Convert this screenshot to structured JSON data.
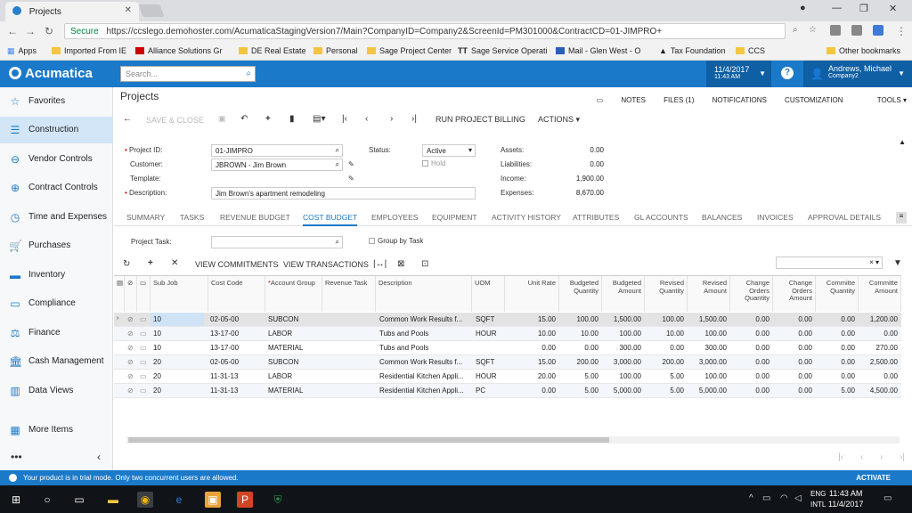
{
  "browser": {
    "tab_title": "Projects",
    "secure_label": "Secure",
    "url": "https://ccslego.demohoster.com/AcumaticaStagingVersion7/Main?CompanyID=Company2&ScreenId=PM301000&ContractCD=01-JIMPRO+",
    "bookmarks": [
      "Apps",
      "Imported From IE",
      "Alliance Solutions Gr",
      "DE Real Estate",
      "Personal",
      "Sage Project Center",
      "Sage Service Operati",
      "Mail - Glen West - O",
      "Tax Foundation",
      "CCS",
      "Other bookmarks"
    ]
  },
  "app": {
    "brand": "Acumatica",
    "search_placeholder": "Search...",
    "date": "11/4/2017",
    "time": "11:43 AM",
    "user_name": "Andrews, Michael",
    "company": "Company2"
  },
  "sidebar": {
    "items": [
      "Favorites",
      "Construction",
      "Vendor Controls",
      "Contract Controls",
      "Time and Expenses",
      "Purchases",
      "Inventory",
      "Compliance",
      "Finance",
      "Cash Management",
      "Data Views",
      "More Items"
    ],
    "active": "Construction"
  },
  "page": {
    "title": "Projects",
    "top_links": [
      "NOTES",
      "FILES (1)",
      "NOTIFICATIONS",
      "CUSTOMIZATION",
      "TOOLS"
    ],
    "toolbar": {
      "save_close": "SAVE & CLOSE",
      "run_billing": "RUN PROJECT BILLING",
      "actions": "ACTIONS"
    }
  },
  "form": {
    "project_id_label": "Project ID:",
    "project_id": "01-JIMPRO",
    "customer_label": "Customer:",
    "customer": "JBROWN - Jim Brown",
    "template_label": "Template:",
    "template": "",
    "description_label": "Description:",
    "description": "Jim Brown's apartment remodeling",
    "status_label": "Status:",
    "status": "Active",
    "hold_label": "Hold",
    "assets_label": "Assets:",
    "assets": "0.00",
    "liabilities_label": "Liabilities:",
    "liabilities": "0.00",
    "income_label": "Income:",
    "income": "1,900.00",
    "expenses_label": "Expenses:",
    "expenses": "8,670.00"
  },
  "tabs": [
    "SUMMARY",
    "TASKS",
    "REVENUE BUDGET",
    "COST BUDGET",
    "EMPLOYEES",
    "EQUIPMENT",
    "ACTIVITY HISTORY",
    "ATTRIBUTES",
    "GL ACCOUNTS",
    "BALANCES",
    "INVOICES",
    "APPROVAL DETAILS"
  ],
  "active_tab": "COST BUDGET",
  "filter": {
    "project_task_label": "Project Task:",
    "group_by_task_label": "Group by Task"
  },
  "grid_toolbar": {
    "view_commitments": "VIEW COMMITMENTS",
    "view_transactions": "VIEW TRANSACTIONS"
  },
  "grid": {
    "headers": [
      "Sub Job",
      "Cost Code",
      "Account Group",
      "Revenue Task",
      "Description",
      "UOM",
      "Unit Rate",
      "Budgeted Quantity",
      "Budgeted Amount",
      "Revised Quantity",
      "Revised Amount",
      "Change Orders Quantity",
      "Change Orders Amount",
      "Committe Quantity",
      "Committe Amount"
    ],
    "rows": [
      [
        "10",
        "02-05-00",
        "SUBCON",
        "",
        "Common Work Results f...",
        "SQFT",
        "15.00",
        "100.00",
        "1,500.00",
        "100.00",
        "1,500.00",
        "0.00",
        "0.00",
        "0.00",
        "1,200.00"
      ],
      [
        "10",
        "13-17-00",
        "LABOR",
        "",
        "Tubs and Pools",
        "HOUR",
        "10.00",
        "10.00",
        "100.00",
        "10.00",
        "100.00",
        "0.00",
        "0.00",
        "0.00",
        "0.00"
      ],
      [
        "10",
        "13-17-00",
        "MATERIAL",
        "",
        "Tubs and Pools",
        "",
        "0.00",
        "0.00",
        "300.00",
        "0.00",
        "300.00",
        "0.00",
        "0.00",
        "0.00",
        "270.00"
      ],
      [
        "20",
        "02-05-00",
        "SUBCON",
        "",
        "Common Work Results f...",
        "SQFT",
        "15.00",
        "200.00",
        "3,000.00",
        "200.00",
        "3,000.00",
        "0.00",
        "0.00",
        "0.00",
        "2,500.00"
      ],
      [
        "20",
        "11-31-13",
        "LABOR",
        "",
        "Residential Kitchen Appli...",
        "HOUR",
        "20.00",
        "5.00",
        "100.00",
        "5.00",
        "100.00",
        "0.00",
        "0.00",
        "0.00",
        "0.00"
      ],
      [
        "20",
        "11-31-13",
        "MATERIAL",
        "",
        "Residential Kitchen Appli...",
        "PC",
        "0.00",
        "5.00",
        "5,000.00",
        "5.00",
        "5,000.00",
        "0.00",
        "0.00",
        "5.00",
        "4,500.00"
      ]
    ]
  },
  "trial_banner": {
    "message": "Your product is in trial mode. Only two concurrent users are allowed.",
    "activate": "ACTIVATE"
  },
  "taskbar": {
    "lang1": "ENG",
    "lang2": "INTL",
    "time": "11:43 AM",
    "date": "11/4/2017"
  }
}
